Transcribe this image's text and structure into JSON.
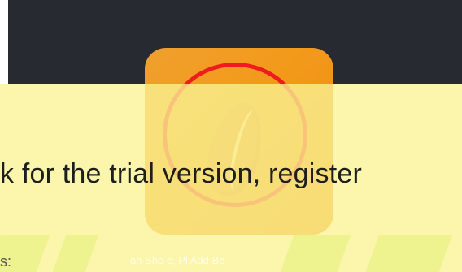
{
  "banner": {
    "message": "k for the trial version, register",
    "sub_label": "s:",
    "faded_hint": "an Sho    e, Pl      Add Be"
  },
  "colors": {
    "topbar": "#272a31",
    "tile_orange": "#f29a1b",
    "ring_red": "#ee1c1c",
    "banner_yellow": "#faf494"
  },
  "icons": {
    "app_tile": "coffee-bean-icon"
  }
}
